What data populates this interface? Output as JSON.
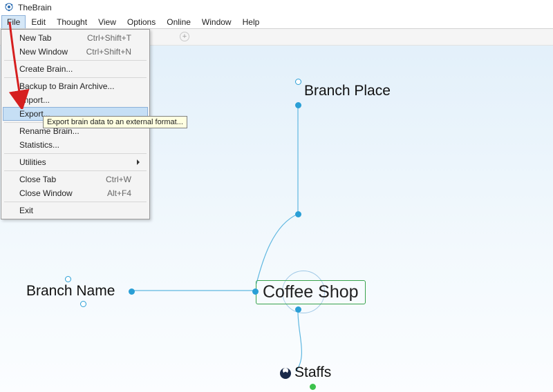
{
  "title": "TheBrain",
  "menus": [
    "File",
    "Edit",
    "Thought",
    "View",
    "Options",
    "Online",
    "Window",
    "Help"
  ],
  "open_menu": "File",
  "file_menu": {
    "groups": [
      [
        {
          "label": "New Tab",
          "kbd": "Ctrl+Shift+T"
        },
        {
          "label": "New Window",
          "kbd": "Ctrl+Shift+N"
        }
      ],
      [
        {
          "label": "Create Brain..."
        }
      ],
      [
        {
          "label": "Backup to Brain Archive..."
        },
        {
          "label": "Import..."
        },
        {
          "label": "Export...",
          "highlight": true,
          "tooltip": "Export brain data to an external format..."
        }
      ],
      [
        {
          "label": "Rename Brain..."
        },
        {
          "label": "Statistics..."
        }
      ],
      [
        {
          "label": "Utilities",
          "submenu": true
        }
      ],
      [
        {
          "label": "Close Tab",
          "kbd": "Ctrl+W"
        },
        {
          "label": "Close Window",
          "kbd": "Alt+F4"
        }
      ],
      [
        {
          "label": "Exit"
        }
      ]
    ]
  },
  "graph": {
    "center": "Coffee Shop",
    "top": "Branch Place",
    "left": "Branch Name",
    "bottom": "Staffs"
  },
  "colors": {
    "link": "#5fb7e0",
    "node_border": "#37a24b"
  }
}
